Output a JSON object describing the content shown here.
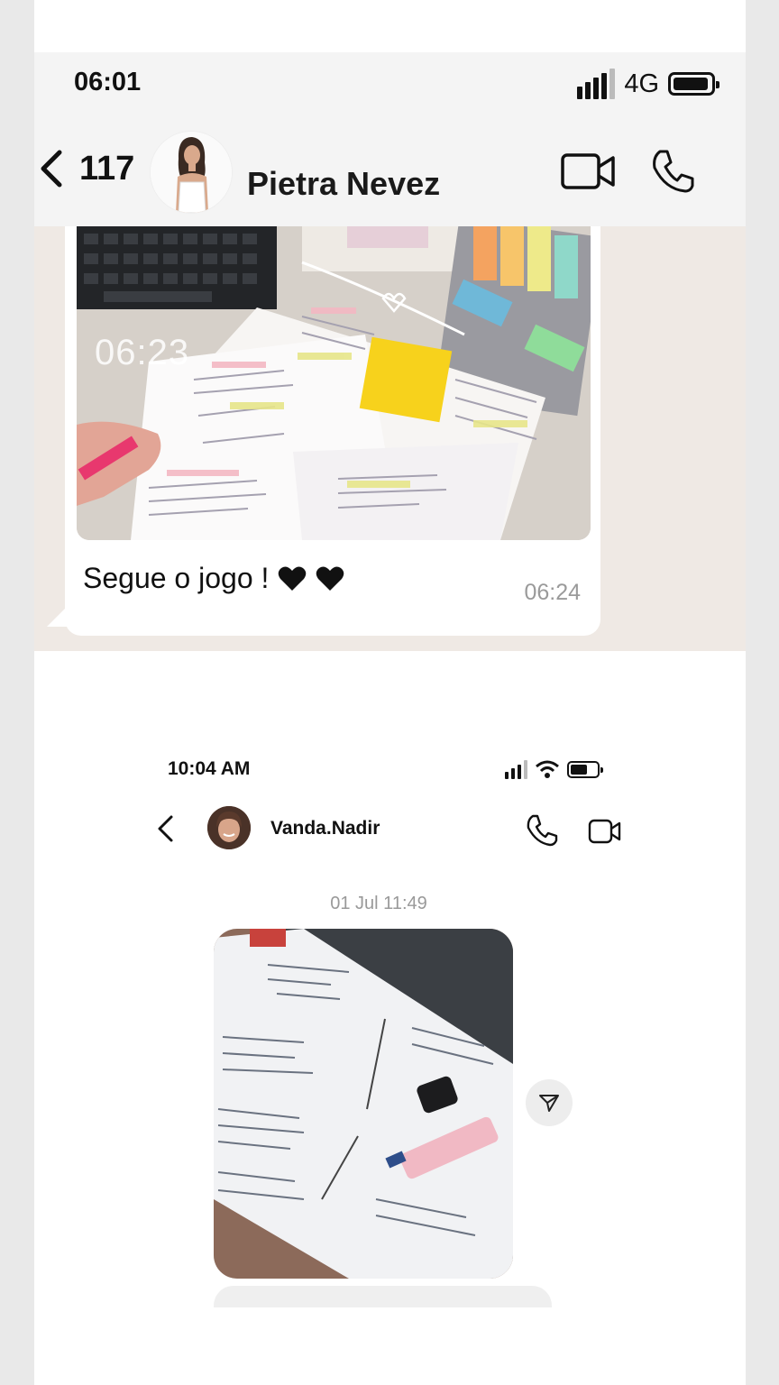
{
  "whatsapp": {
    "status_bar": {
      "time": "06:01",
      "network": "4G"
    },
    "header": {
      "unread_count": "117",
      "contact_name": "Pietra Nevez"
    },
    "message": {
      "photo_timestamp_overlay": "06:23",
      "caption": "Segue o jogo !",
      "time": "06:24"
    }
  },
  "instagram": {
    "status_bar": {
      "time": "10:04 AM"
    },
    "header": {
      "contact_name": "Vanda.Nadir"
    },
    "date_separator": "01 Jul 11:49"
  },
  "colors": {
    "page_bg": "#e9e9e9",
    "wa_header_bg": "#f4f4f4",
    "wa_chat_bg": "#efe9e4",
    "bubble_bg": "#ffffff",
    "secondary_text": "#9a9a9a"
  }
}
